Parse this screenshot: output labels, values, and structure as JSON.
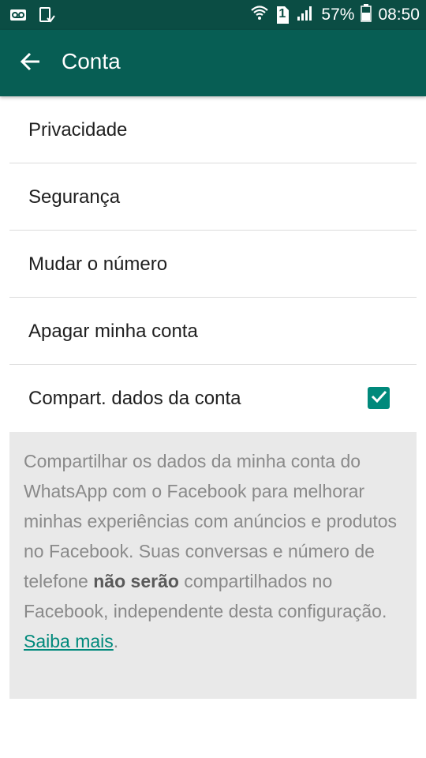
{
  "status_bar": {
    "sim_slot": "1",
    "battery": "57%",
    "time": "08:50"
  },
  "app_bar": {
    "title": "Conta"
  },
  "menu": {
    "items": [
      {
        "label": "Privacidade"
      },
      {
        "label": "Segurança"
      },
      {
        "label": "Mudar o número"
      },
      {
        "label": "Apagar minha conta"
      },
      {
        "label": "Compart. dados da conta",
        "checked": true
      }
    ]
  },
  "description": {
    "text_before": "Compartilhar os dados da minha conta do WhatsApp com o Facebook para melhorar minhas experiências com anúncios e produtos no Facebook. Suas conversas e número de telefone ",
    "bold_text": "não serão",
    "text_after": " compartilhados no Facebook, independente desta configuração. ",
    "link_text": "Saiba mais",
    "end_text": "."
  },
  "colors": {
    "status_bar": "#0b4d44",
    "app_bar": "#075e54",
    "accent": "#00897b"
  }
}
